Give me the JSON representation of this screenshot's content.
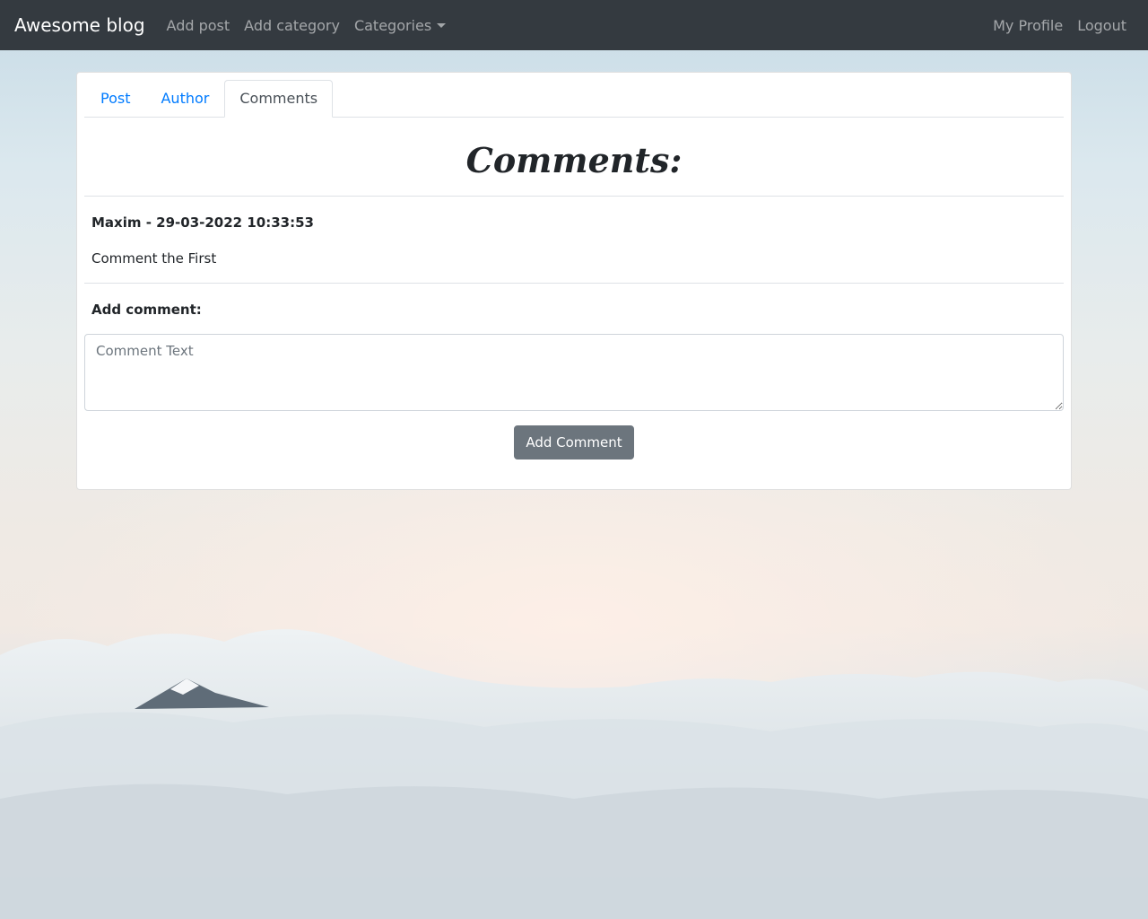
{
  "navbar": {
    "brand": "Awesome blog",
    "links": {
      "add_post": "Add post",
      "add_category": "Add category",
      "categories": "Categories"
    },
    "right_links": {
      "my_profile": "My Profile",
      "logout": "Logout"
    }
  },
  "tabs": {
    "post": "Post",
    "author": "Author",
    "comments": "Comments",
    "active": "Comments"
  },
  "comments": {
    "heading": "Comments:",
    "items": [
      {
        "author": "Maxim",
        "date": "29-03-2022 10:33:53",
        "meta": "Maxim - 29-03-2022 10:33:53",
        "text": "Comment the First"
      }
    ]
  },
  "add_comment": {
    "label": "Add comment:",
    "placeholder": "Comment Text",
    "button": "Add Comment"
  },
  "colors": {
    "navbar_bg": "#343a40",
    "tab_link": "#007bff",
    "button_bg": "#6c757d"
  }
}
